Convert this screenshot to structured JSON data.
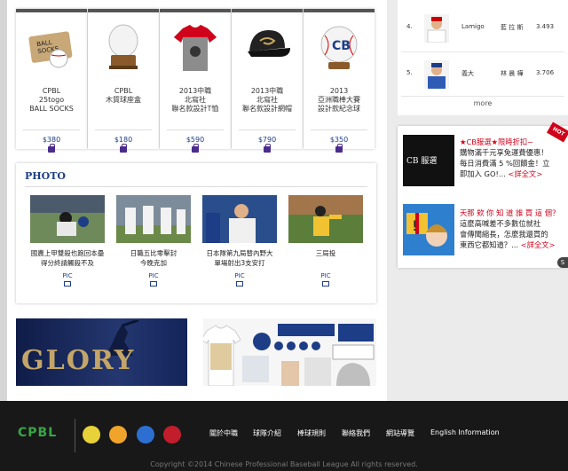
{
  "products": [
    {
      "name": "CPBL\n25togo\nBALL SOCKS",
      "price": "$380"
    },
    {
      "name": "CPBL\n木質球座盒",
      "price": "$180"
    },
    {
      "name": "2013中職\n北寫社\n聯名款設計T恤",
      "price": "$590"
    },
    {
      "name": "2013中職\n北寫社\n聯名款設計網帽",
      "price": "$790"
    },
    {
      "name": "2013\n亞洲職棒大賽\n設計款紀念球",
      "price": "$350"
    }
  ],
  "photo": {
    "title": "PHOTO",
    "pic_label": "PIC",
    "items": [
      {
        "caption": "國農上甲雙殺也跑回本壘\n得分終請觸殺不及"
      },
      {
        "caption": "日職五比零擊封\n今晚克加"
      },
      {
        "caption": "日本隊第九局替內野大\n單場射出3支安打"
      },
      {
        "caption": "三局投"
      }
    ]
  },
  "banners": {
    "glory": "GLORY"
  },
  "ranking": {
    "rows": [
      {
        "num": "4.",
        "team": "Lamigo",
        "player": "藍 拉 斯",
        "avg": "3.493"
      },
      {
        "num": "5.",
        "team": "義大",
        "player": "林 晨 樺",
        "avg": "3.706"
      }
    ],
    "more": "more"
  },
  "news": [
    {
      "brand": "CB 服選",
      "headline": "★CB服選★限時折扣~",
      "body": "購物滿千元享免運費優惠！\n每日消費滿 5 %回饋金！立\n即加入 GO!...",
      "more": "<詳全文>"
    },
    {
      "headline": "天那 欸 你 知 道 誰 買 這 個？",
      "body": "這麼高喊差不多數位就社\n會傳聞縮長，怎麼我還買的\n東西它都知道？...",
      "more": "<詳全文>"
    }
  ],
  "hot_label": "HOT",
  "footer": {
    "logo": "CPBL",
    "nav": [
      "關於中職",
      "球隊介紹",
      "棒球規則",
      "聯絡我們",
      "網站導覽",
      "English Information"
    ],
    "copyright": "Copyright ©2014 Chinese Professional Baseball League All rights reserved."
  },
  "colors": {
    "brand_blue": "#1d3d86",
    "red": "#d0021b",
    "footer": "#181818"
  }
}
